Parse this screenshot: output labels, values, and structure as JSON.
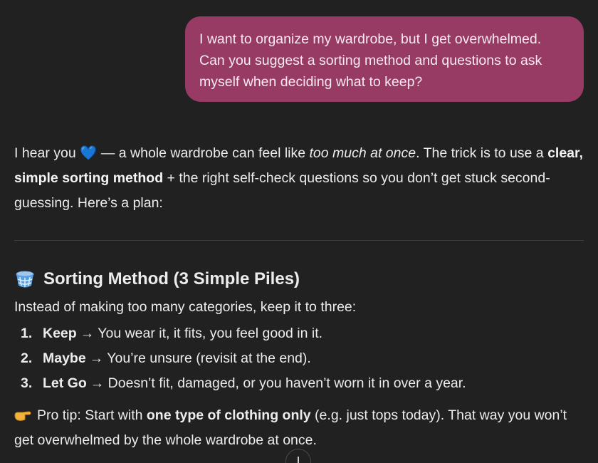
{
  "user_message": {
    "line1": "I want to organize my wardrobe, but I get overwhelmed.",
    "line2": "Can you suggest a sorting method and questions to ask",
    "line3": "myself when deciding what to keep?"
  },
  "assistant": {
    "intro": {
      "part1": "I hear you ",
      "heart": "💙",
      "part2": " — a whole wardrobe can feel like ",
      "italic": "too much at once",
      "part3": ". The trick is to use a ",
      "bold": "clear, simple sorting method",
      "part4": " + the right self-check questions so you don’t get stuck second-guessing. Here’s a plan:"
    },
    "section": {
      "heading": "Sorting Method (3 Simple Piles)",
      "intro": "Instead of making too many categories, keep it to three:",
      "steps": [
        {
          "num": "1.",
          "term": "Keep",
          "text": "→ You wear it, it fits, you feel good in it."
        },
        {
          "num": "2.",
          "term": "Maybe",
          "text": "→ You’re unsure (revisit at the end)."
        },
        {
          "num": "3.",
          "term": "Let Go",
          "text": "→ Doesn’t fit, damaged, or you haven’t worn it in over a year."
        }
      ],
      "tip": {
        "part1": "Pro tip: Start with ",
        "bold": "one type of clothing only",
        "part2": " (e.g. just tops today). That way you won’t get overwhelmed by the whole wardrobe at once."
      }
    }
  },
  "icons": {
    "section_icon": "basket-icon",
    "tip_icon": "pointing-hand-icon",
    "scroll_icon": "arrow-down-icon"
  },
  "colors": {
    "background": "#212121",
    "user_bubble": "#983b64",
    "heart": "#2f7fe0",
    "pointer": "#f2b33d"
  }
}
